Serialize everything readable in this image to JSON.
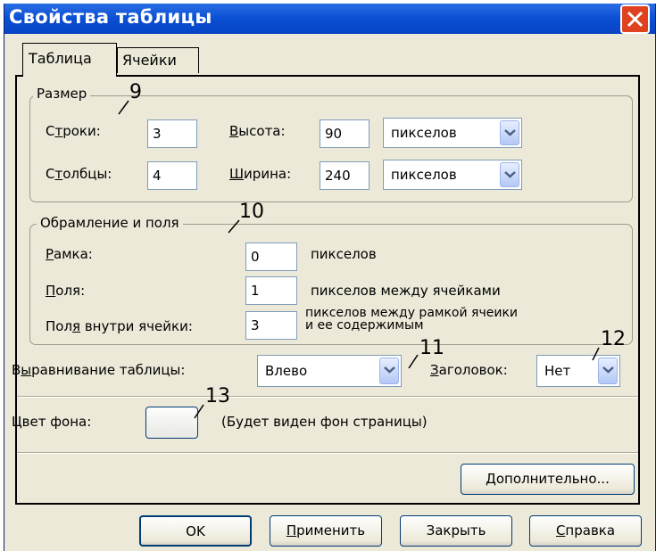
{
  "window": {
    "title": "Свойства таблицы"
  },
  "tabs": [
    {
      "label": "Таблица",
      "active": true
    },
    {
      "label": "Ячейки",
      "active": false
    }
  ],
  "size_group": {
    "title": "Размер",
    "rows_label_a": "С",
    "rows_label_u": "т",
    "rows_label_b": "роки:",
    "rows_value": "3",
    "cols_label_a": "С",
    "cols_label_u": "т",
    "cols_label_b": "олбцы:",
    "cols_value": "4",
    "height_label_u": "В",
    "height_label_b": "ысота:",
    "height_value": "90",
    "height_unit": "пикселов",
    "width_label_u": "Ш",
    "width_label_b": "ирина:",
    "width_value": "240",
    "width_unit": "пикселов"
  },
  "border_group": {
    "title": "Обрамление и поля",
    "frame_label_u": "Р",
    "frame_label_b": "амка:",
    "frame_value": "0",
    "frame_unit": "пикселов",
    "padding_label_u": "П",
    "padding_label_b": "оля:",
    "padding_value": "1",
    "padding_unit": "пикселов между ячейками",
    "spacing_label_a": "Пол",
    "spacing_label_u": "я",
    "spacing_label_b": " внутри ячейки:",
    "spacing_value": "3",
    "spacing_unit": "пикселов между рамкой ячеики и ее содержимым"
  },
  "alignment": {
    "label_a": "В",
    "label_u": "ы",
    "label_b": "равнивание таблицы:",
    "value": "Влево"
  },
  "header": {
    "label_u": "З",
    "label_b": "аголовок:",
    "value": "Нет"
  },
  "background": {
    "label": "Цвет фона:",
    "hint": "(Будет виден фон страницы)"
  },
  "advanced_button": {
    "label_u": "Д",
    "label_b": "ополнительно..."
  },
  "buttons": {
    "ok": "OK",
    "apply_u": "П",
    "apply_b": "рименить",
    "close": "Закрыть",
    "help_u": "С",
    "help_b": "правка"
  },
  "annotations": [
    "9",
    "10",
    "11",
    "12",
    "13"
  ],
  "colors": {
    "titlebar": "#0a4fd3",
    "close": "#e0421f",
    "dialog": "#ece9d8"
  }
}
